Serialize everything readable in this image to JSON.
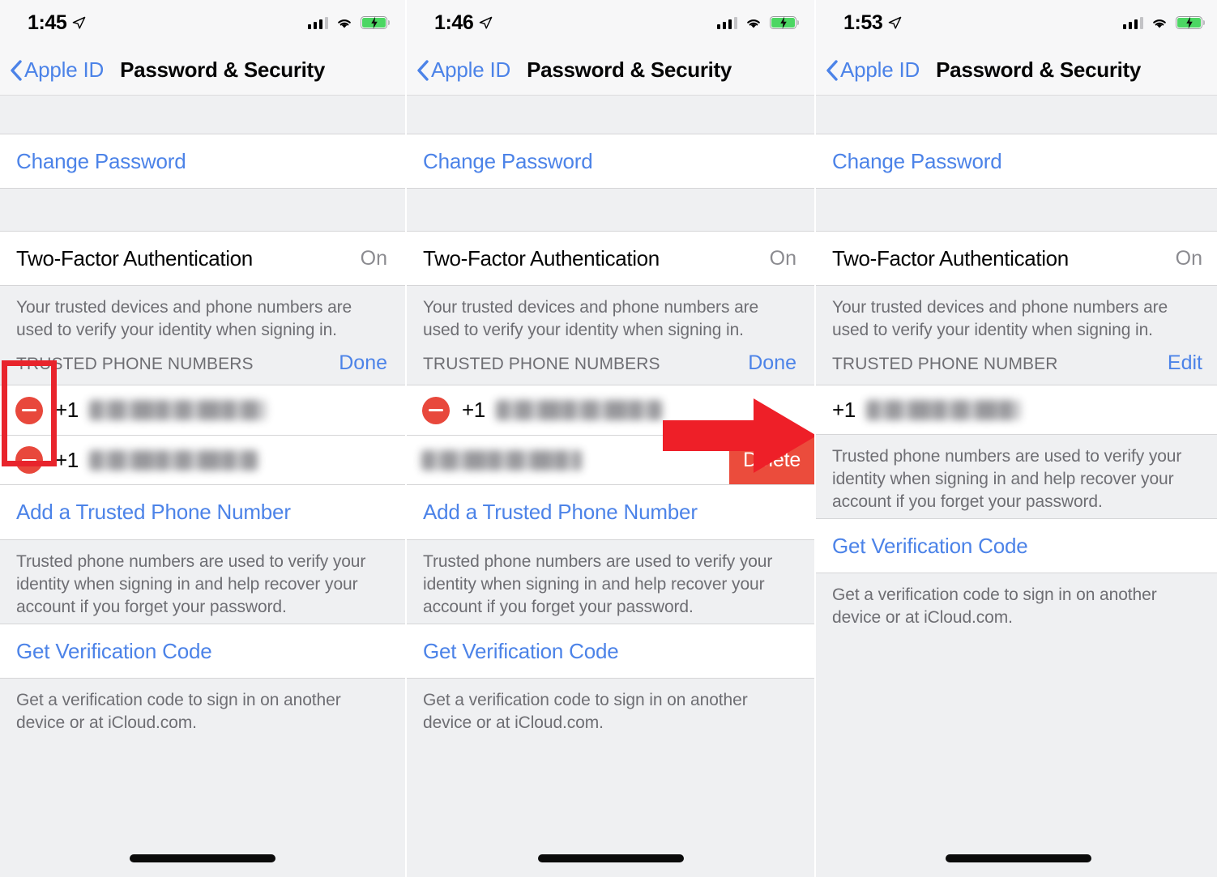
{
  "panels": [
    {
      "status": {
        "time": "1:45",
        "location_icon": "location-arrow-icon",
        "signal_icon": "cellular-bars-icon",
        "wifi_icon": "wifi-icon",
        "battery_icon": "battery-charging-icon"
      },
      "nav": {
        "back_label": "Apple ID",
        "back_icon": "chevron-left-icon",
        "title": "Password & Security"
      },
      "change_password": "Change Password",
      "two_factor": {
        "title": "Two-Factor Authentication",
        "value": "On"
      },
      "two_factor_footnote": "Your trusted devices and phone numbers are used to verify your identity when signing in.",
      "group_header": {
        "label": "TRUSTED PHONE NUMBERS",
        "action": "Done"
      },
      "phones": [
        {
          "country_code": "+1",
          "number": "",
          "edit_icon": "minus-circle-icon"
        },
        {
          "country_code": "+1",
          "number": "",
          "edit_icon": "minus-circle-icon"
        }
      ],
      "add_phone": "Add a Trusted Phone Number",
      "phones_footnote": "Trusted phone numbers are used to verify your identity when signing in and help recover your account if you forget your password.",
      "get_code": "Get Verification Code",
      "get_code_footnote": "Get a verification code to sign in on another device or at iCloud.com."
    },
    {
      "status": {
        "time": "1:46",
        "location_icon": "location-arrow-icon",
        "signal_icon": "cellular-bars-icon",
        "wifi_icon": "wifi-icon",
        "battery_icon": "battery-charging-icon"
      },
      "nav": {
        "back_label": "Apple ID",
        "back_icon": "chevron-left-icon",
        "title": "Password & Security"
      },
      "change_password": "Change Password",
      "two_factor": {
        "title": "Two-Factor Authentication",
        "value": "On"
      },
      "two_factor_footnote": "Your trusted devices and phone numbers are used to verify your identity when signing in.",
      "group_header": {
        "label": "TRUSTED PHONE NUMBERS",
        "action": "Done"
      },
      "phones": [
        {
          "country_code": "+1",
          "number": "",
          "edit_icon": "minus-circle-icon"
        },
        {
          "country_code": "",
          "number": "",
          "edit_icon": "",
          "swiped": true,
          "delete_label": "Delete"
        }
      ],
      "add_phone": "Add a Trusted Phone Number",
      "phones_footnote": "Trusted phone numbers are used to verify your identity when signing in and help recover your account if you forget your password.",
      "get_code": "Get Verification Code",
      "get_code_footnote": "Get a verification code to sign in on another device or at iCloud.com."
    },
    {
      "status": {
        "time": "1:53",
        "location_icon": "location-arrow-icon",
        "signal_icon": "cellular-bars-icon",
        "wifi_icon": "wifi-icon",
        "battery_icon": "battery-charging-icon"
      },
      "nav": {
        "back_label": "Apple ID",
        "back_icon": "chevron-left-icon",
        "title": "Password & Security"
      },
      "change_password": "Change Password",
      "two_factor": {
        "title": "Two-Factor Authentication",
        "value": "On"
      },
      "two_factor_footnote": "Your trusted devices and phone numbers are used to verify your identity when signing in.",
      "group_header": {
        "label": "TRUSTED PHONE NUMBER",
        "action": "Edit"
      },
      "phones": [
        {
          "country_code": "+1",
          "number": "",
          "edit_icon": ""
        }
      ],
      "phones_footnote": "Trusted phone numbers are used to verify your identity when signing in and help recover your account if you forget your password.",
      "get_code": "Get Verification Code",
      "get_code_footnote": "Get a verification code to sign in on another device or at iCloud.com."
    }
  ],
  "annotations": {
    "rect_color": "#e8242c",
    "arrow_color": "#ee1f28",
    "delete_button_color": "#eb4c3c",
    "minus_button_color": "#e8483c",
    "link_color": "#4c83e8"
  }
}
